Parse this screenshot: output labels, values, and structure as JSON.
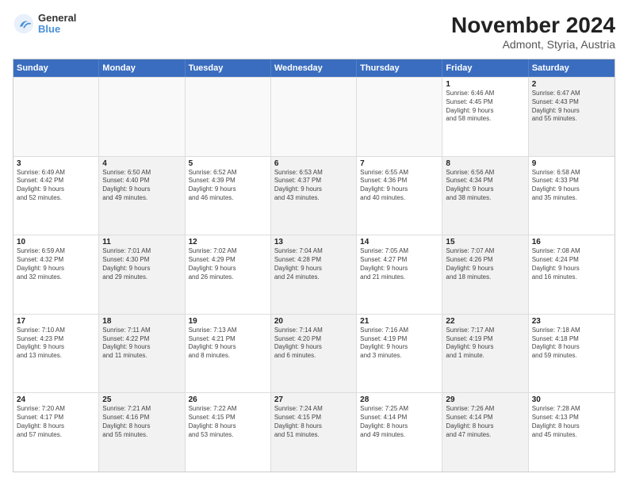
{
  "logo": {
    "line1": "General",
    "line2": "Blue"
  },
  "title": "November 2024",
  "subtitle": "Admont, Styria, Austria",
  "days_of_week": [
    "Sunday",
    "Monday",
    "Tuesday",
    "Wednesday",
    "Thursday",
    "Friday",
    "Saturday"
  ],
  "weeks": [
    [
      {
        "day": "",
        "info": "",
        "shaded": false,
        "empty": true
      },
      {
        "day": "",
        "info": "",
        "shaded": false,
        "empty": true
      },
      {
        "day": "",
        "info": "",
        "shaded": false,
        "empty": true
      },
      {
        "day": "",
        "info": "",
        "shaded": false,
        "empty": true
      },
      {
        "day": "",
        "info": "",
        "shaded": false,
        "empty": true
      },
      {
        "day": "1",
        "info": "Sunrise: 6:46 AM\nSunset: 4:45 PM\nDaylight: 9 hours\nand 58 minutes.",
        "shaded": false,
        "empty": false
      },
      {
        "day": "2",
        "info": "Sunrise: 6:47 AM\nSunset: 4:43 PM\nDaylight: 9 hours\nand 55 minutes.",
        "shaded": true,
        "empty": false
      }
    ],
    [
      {
        "day": "3",
        "info": "Sunrise: 6:49 AM\nSunset: 4:42 PM\nDaylight: 9 hours\nand 52 minutes.",
        "shaded": false,
        "empty": false
      },
      {
        "day": "4",
        "info": "Sunrise: 6:50 AM\nSunset: 4:40 PM\nDaylight: 9 hours\nand 49 minutes.",
        "shaded": true,
        "empty": false
      },
      {
        "day": "5",
        "info": "Sunrise: 6:52 AM\nSunset: 4:39 PM\nDaylight: 9 hours\nand 46 minutes.",
        "shaded": false,
        "empty": false
      },
      {
        "day": "6",
        "info": "Sunrise: 6:53 AM\nSunset: 4:37 PM\nDaylight: 9 hours\nand 43 minutes.",
        "shaded": true,
        "empty": false
      },
      {
        "day": "7",
        "info": "Sunrise: 6:55 AM\nSunset: 4:36 PM\nDaylight: 9 hours\nand 40 minutes.",
        "shaded": false,
        "empty": false
      },
      {
        "day": "8",
        "info": "Sunrise: 6:56 AM\nSunset: 4:34 PM\nDaylight: 9 hours\nand 38 minutes.",
        "shaded": true,
        "empty": false
      },
      {
        "day": "9",
        "info": "Sunrise: 6:58 AM\nSunset: 4:33 PM\nDaylight: 9 hours\nand 35 minutes.",
        "shaded": false,
        "empty": false
      }
    ],
    [
      {
        "day": "10",
        "info": "Sunrise: 6:59 AM\nSunset: 4:32 PM\nDaylight: 9 hours\nand 32 minutes.",
        "shaded": false,
        "empty": false
      },
      {
        "day": "11",
        "info": "Sunrise: 7:01 AM\nSunset: 4:30 PM\nDaylight: 9 hours\nand 29 minutes.",
        "shaded": true,
        "empty": false
      },
      {
        "day": "12",
        "info": "Sunrise: 7:02 AM\nSunset: 4:29 PM\nDaylight: 9 hours\nand 26 minutes.",
        "shaded": false,
        "empty": false
      },
      {
        "day": "13",
        "info": "Sunrise: 7:04 AM\nSunset: 4:28 PM\nDaylight: 9 hours\nand 24 minutes.",
        "shaded": true,
        "empty": false
      },
      {
        "day": "14",
        "info": "Sunrise: 7:05 AM\nSunset: 4:27 PM\nDaylight: 9 hours\nand 21 minutes.",
        "shaded": false,
        "empty": false
      },
      {
        "day": "15",
        "info": "Sunrise: 7:07 AM\nSunset: 4:26 PM\nDaylight: 9 hours\nand 18 minutes.",
        "shaded": true,
        "empty": false
      },
      {
        "day": "16",
        "info": "Sunrise: 7:08 AM\nSunset: 4:24 PM\nDaylight: 9 hours\nand 16 minutes.",
        "shaded": false,
        "empty": false
      }
    ],
    [
      {
        "day": "17",
        "info": "Sunrise: 7:10 AM\nSunset: 4:23 PM\nDaylight: 9 hours\nand 13 minutes.",
        "shaded": false,
        "empty": false
      },
      {
        "day": "18",
        "info": "Sunrise: 7:11 AM\nSunset: 4:22 PM\nDaylight: 9 hours\nand 11 minutes.",
        "shaded": true,
        "empty": false
      },
      {
        "day": "19",
        "info": "Sunrise: 7:13 AM\nSunset: 4:21 PM\nDaylight: 9 hours\nand 8 minutes.",
        "shaded": false,
        "empty": false
      },
      {
        "day": "20",
        "info": "Sunrise: 7:14 AM\nSunset: 4:20 PM\nDaylight: 9 hours\nand 6 minutes.",
        "shaded": true,
        "empty": false
      },
      {
        "day": "21",
        "info": "Sunrise: 7:16 AM\nSunset: 4:19 PM\nDaylight: 9 hours\nand 3 minutes.",
        "shaded": false,
        "empty": false
      },
      {
        "day": "22",
        "info": "Sunrise: 7:17 AM\nSunset: 4:19 PM\nDaylight: 9 hours\nand 1 minute.",
        "shaded": true,
        "empty": false
      },
      {
        "day": "23",
        "info": "Sunrise: 7:18 AM\nSunset: 4:18 PM\nDaylight: 8 hours\nand 59 minutes.",
        "shaded": false,
        "empty": false
      }
    ],
    [
      {
        "day": "24",
        "info": "Sunrise: 7:20 AM\nSunset: 4:17 PM\nDaylight: 8 hours\nand 57 minutes.",
        "shaded": false,
        "empty": false
      },
      {
        "day": "25",
        "info": "Sunrise: 7:21 AM\nSunset: 4:16 PM\nDaylight: 8 hours\nand 55 minutes.",
        "shaded": true,
        "empty": false
      },
      {
        "day": "26",
        "info": "Sunrise: 7:22 AM\nSunset: 4:15 PM\nDaylight: 8 hours\nand 53 minutes.",
        "shaded": false,
        "empty": false
      },
      {
        "day": "27",
        "info": "Sunrise: 7:24 AM\nSunset: 4:15 PM\nDaylight: 8 hours\nand 51 minutes.",
        "shaded": true,
        "empty": false
      },
      {
        "day": "28",
        "info": "Sunrise: 7:25 AM\nSunset: 4:14 PM\nDaylight: 8 hours\nand 49 minutes.",
        "shaded": false,
        "empty": false
      },
      {
        "day": "29",
        "info": "Sunrise: 7:26 AM\nSunset: 4:14 PM\nDaylight: 8 hours\nand 47 minutes.",
        "shaded": true,
        "empty": false
      },
      {
        "day": "30",
        "info": "Sunrise: 7:28 AM\nSunset: 4:13 PM\nDaylight: 8 hours\nand 45 minutes.",
        "shaded": false,
        "empty": false
      }
    ]
  ]
}
